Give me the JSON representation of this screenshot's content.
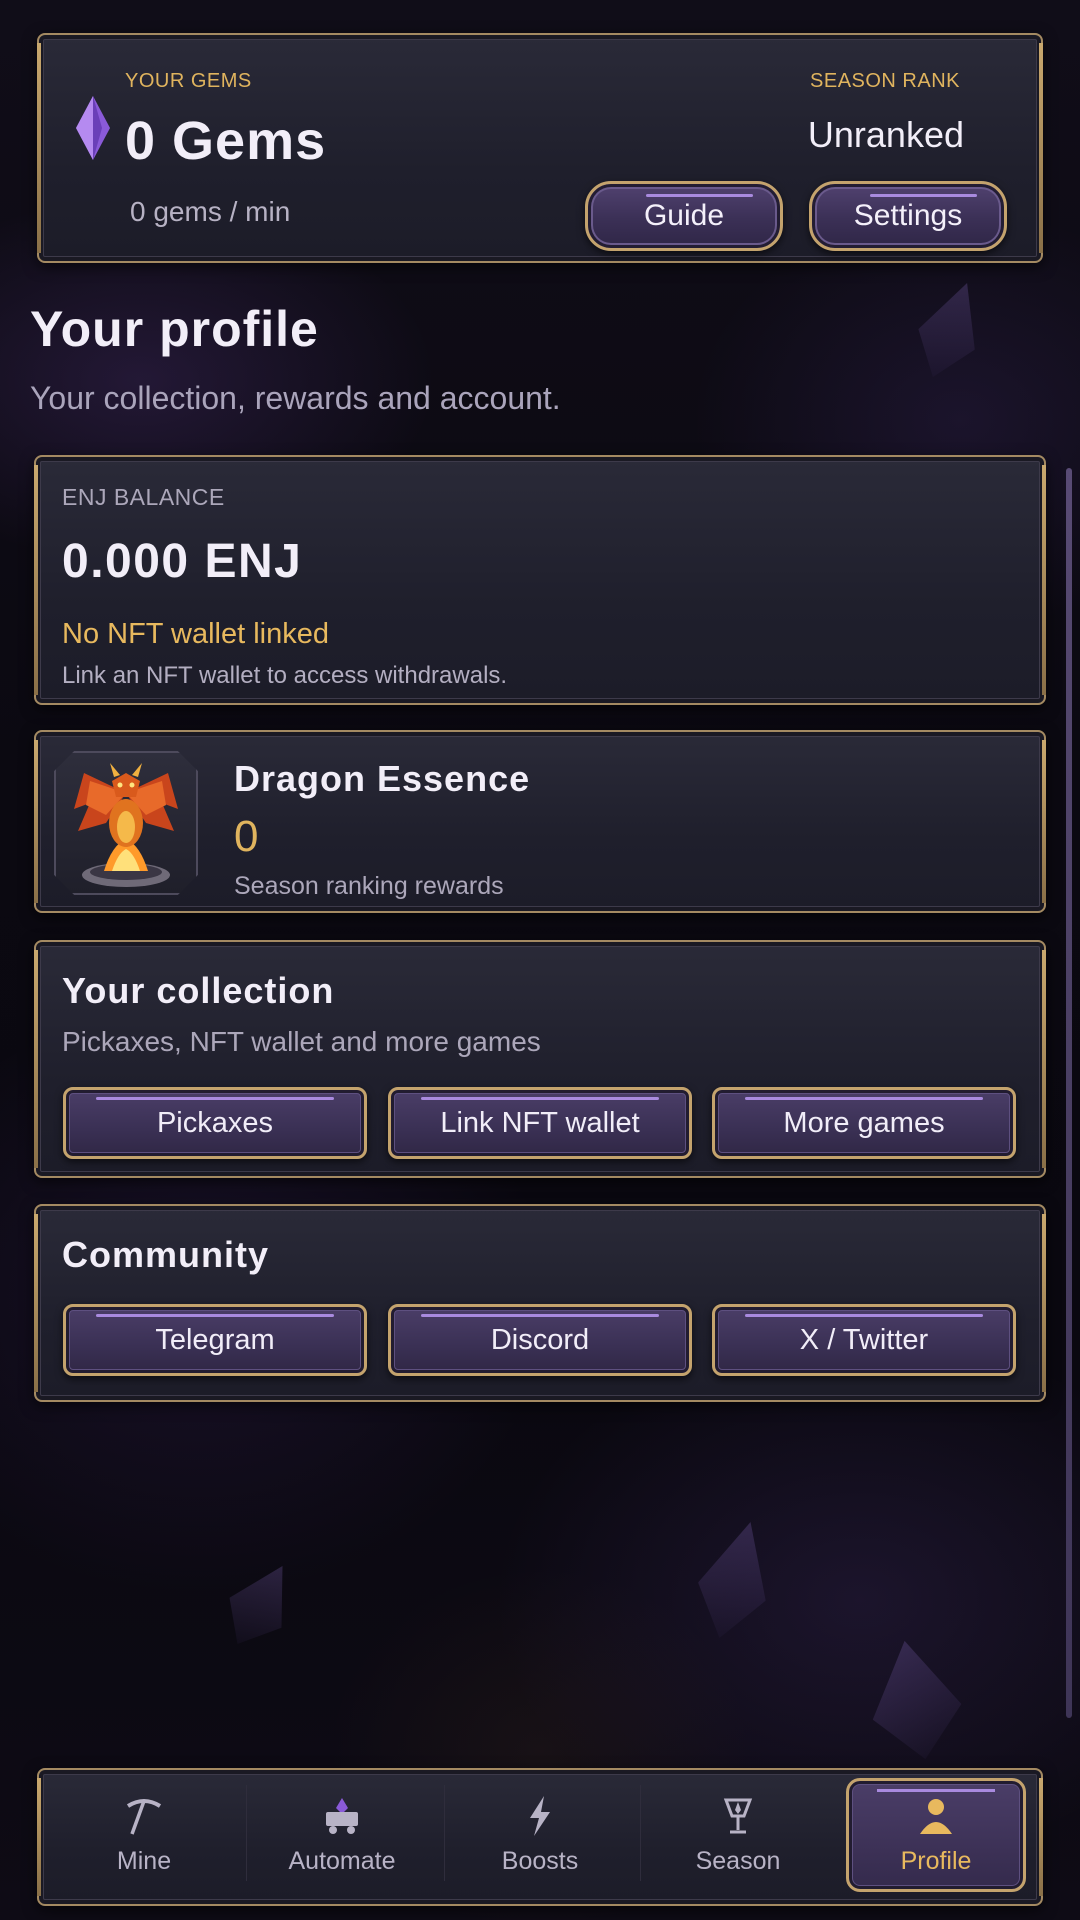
{
  "top_bar": {
    "gems_label": "YOUR GEMS",
    "gems_value": "0 Gems",
    "gems_rate": "0 gems / min",
    "rank_label": "SEASON RANK",
    "rank_value": "Unranked",
    "guide_button": "Guide",
    "settings_button": "Settings",
    "gem_icon": "purple-crystal-icon"
  },
  "profile": {
    "title": "Your profile",
    "subtitle": "Your collection, rewards and account."
  },
  "enj": {
    "label": "ENJ BALANCE",
    "value": "0.000 ENJ",
    "warning": "No NFT wallet linked",
    "hint": "Link an NFT wallet to access withdrawals."
  },
  "dragon": {
    "title": "Dragon Essence",
    "value": "0",
    "subtitle": "Season ranking rewards",
    "icon": "dragon-icon"
  },
  "collection": {
    "title": "Your collection",
    "subtitle": "Pickaxes, NFT wallet and more games",
    "buttons": [
      "Pickaxes",
      "Link NFT wallet",
      "More games"
    ]
  },
  "community": {
    "title": "Community",
    "buttons": [
      "Telegram",
      "Discord",
      "X / Twitter"
    ]
  },
  "nav": {
    "items": [
      {
        "label": "Mine",
        "icon": "pickaxe-icon"
      },
      {
        "label": "Automate",
        "icon": "minecart-icon"
      },
      {
        "label": "Boosts",
        "icon": "lightning-icon"
      },
      {
        "label": "Season",
        "icon": "trophy-icon"
      },
      {
        "label": "Profile",
        "icon": "person-icon"
      }
    ],
    "active": "Profile"
  },
  "colors": {
    "accent_gold": "#e0b45e",
    "frame_gold": "#c4a36d",
    "button_purple": "#3a3054",
    "highlight_purple": "#a98adf"
  }
}
